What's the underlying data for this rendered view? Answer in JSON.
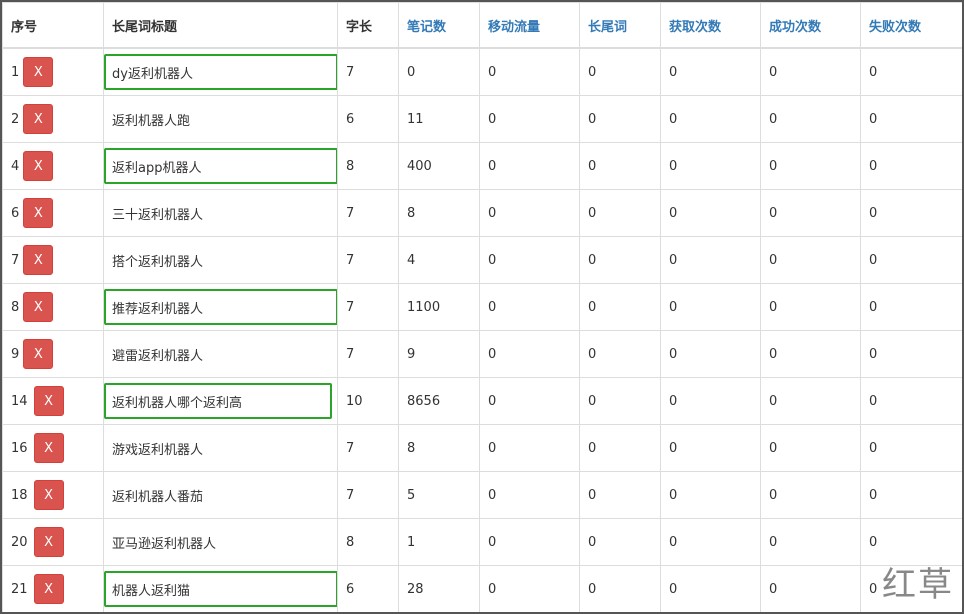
{
  "table": {
    "headers": [
      {
        "label": "序号",
        "sortable": false
      },
      {
        "label": "长尾词标题",
        "sortable": false
      },
      {
        "label": "字长",
        "sortable": false
      },
      {
        "label": "笔记数",
        "sortable": true
      },
      {
        "label": "移动流量",
        "sortable": true
      },
      {
        "label": "长尾词",
        "sortable": true
      },
      {
        "label": "获取次数",
        "sortable": true
      },
      {
        "label": "成功次数",
        "sortable": true
      },
      {
        "label": "失败次数",
        "sortable": true
      }
    ],
    "delete_label": "X",
    "rows": [
      {
        "index": "1",
        "title": "dy返利机器人",
        "length": "7",
        "notes": "0",
        "mobile": "0",
        "longtail": "0",
        "fetch": "0",
        "success": "0",
        "fail": "0",
        "highlighted": true
      },
      {
        "index": "2",
        "title": "返利机器人跑",
        "length": "6",
        "notes": "11",
        "mobile": "0",
        "longtail": "0",
        "fetch": "0",
        "success": "0",
        "fail": "0",
        "highlighted": false
      },
      {
        "index": "4",
        "title": "返利app机器人",
        "length": "8",
        "notes": "400",
        "mobile": "0",
        "longtail": "0",
        "fetch": "0",
        "success": "0",
        "fail": "0",
        "highlighted": true
      },
      {
        "index": "6",
        "title": "三十返利机器人",
        "length": "7",
        "notes": "8",
        "mobile": "0",
        "longtail": "0",
        "fetch": "0",
        "success": "0",
        "fail": "0",
        "highlighted": false
      },
      {
        "index": "7",
        "title": "搭个返利机器人",
        "length": "7",
        "notes": "4",
        "mobile": "0",
        "longtail": "0",
        "fetch": "0",
        "success": "0",
        "fail": "0",
        "highlighted": false
      },
      {
        "index": "8",
        "title": "推荐返利机器人",
        "length": "7",
        "notes": "1100",
        "mobile": "0",
        "longtail": "0",
        "fetch": "0",
        "success": "0",
        "fail": "0",
        "highlighted": true
      },
      {
        "index": "9",
        "title": "避雷返利机器人",
        "length": "7",
        "notes": "9",
        "mobile": "0",
        "longtail": "0",
        "fetch": "0",
        "success": "0",
        "fail": "0",
        "highlighted": false
      },
      {
        "index": "14",
        "title": "返利机器人哪个返利高",
        "length": "10",
        "notes": "8656",
        "mobile": "0",
        "longtail": "0",
        "fetch": "0",
        "success": "0",
        "fail": "0",
        "highlighted": true
      },
      {
        "index": "16",
        "title": "游戏返利机器人",
        "length": "7",
        "notes": "8",
        "mobile": "0",
        "longtail": "0",
        "fetch": "0",
        "success": "0",
        "fail": "0",
        "highlighted": false
      },
      {
        "index": "18",
        "title": "返利机器人番茄",
        "length": "7",
        "notes": "5",
        "mobile": "0",
        "longtail": "0",
        "fetch": "0",
        "success": "0",
        "fail": "0",
        "highlighted": false
      },
      {
        "index": "20",
        "title": "亚马逊返利机器人",
        "length": "8",
        "notes": "1",
        "mobile": "0",
        "longtail": "0",
        "fetch": "0",
        "success": "0",
        "fail": "0",
        "highlighted": false
      },
      {
        "index": "21",
        "title": "机器人返利猫",
        "length": "6",
        "notes": "28",
        "mobile": "0",
        "longtail": "0",
        "fetch": "0",
        "success": "0",
        "fail": "0",
        "highlighted": true
      }
    ]
  },
  "watermark": "红草",
  "colors": {
    "delete_button": "#d9534f",
    "highlight_box": "#2aa52a",
    "sortable_header": "#337ab7"
  }
}
